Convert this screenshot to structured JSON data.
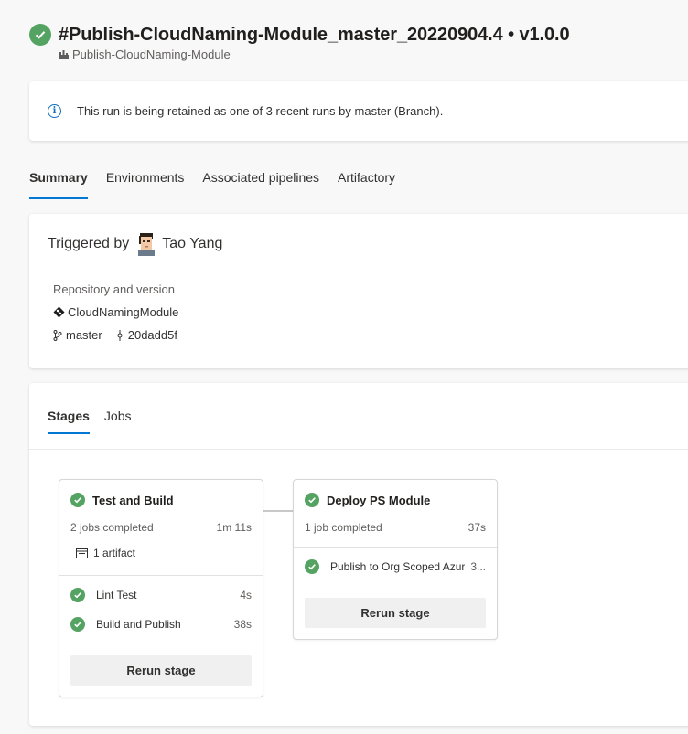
{
  "header": {
    "title": "#Publish-CloudNaming-Module_master_20220904.4 • v1.0.0",
    "pipeline_name": "Publish-CloudNaming-Module",
    "status": "succeeded"
  },
  "banner": {
    "text": "This run is being retained as one of 3 recent runs by master (Branch).",
    "icon": "info-icon"
  },
  "tabs": [
    {
      "label": "Summary",
      "active": true
    },
    {
      "label": "Environments",
      "active": false
    },
    {
      "label": "Associated pipelines",
      "active": false
    },
    {
      "label": "Artifactory",
      "active": false
    }
  ],
  "summary": {
    "triggered_label": "Triggered by",
    "triggered_user": "Tao Yang",
    "repo_label": "Repository and version",
    "repo_name": "CloudNamingModule",
    "branch": "master",
    "commit": "20dadd5f"
  },
  "stages_view": {
    "tabs": [
      {
        "label": "Stages",
        "active": true
      },
      {
        "label": "Jobs",
        "active": false
      }
    ],
    "stages": [
      {
        "name": "Test and Build",
        "jobs_completed": "2 jobs completed",
        "duration": "1m 11s",
        "artifact": "1 artifact",
        "jobs": [
          {
            "name": "Lint Test",
            "time": "4s"
          },
          {
            "name": "Build and Publish",
            "time": "38s"
          }
        ],
        "rerun_label": "Rerun stage"
      },
      {
        "name": "Deploy PS Module",
        "jobs_completed": "1 job completed",
        "duration": "37s",
        "jobs": [
          {
            "name": "Publish to Org Scoped Azur...",
            "time": "3..."
          }
        ],
        "rerun_label": "Rerun stage"
      }
    ]
  },
  "colors": {
    "success": "#55a362",
    "accent": "#0078d4"
  }
}
